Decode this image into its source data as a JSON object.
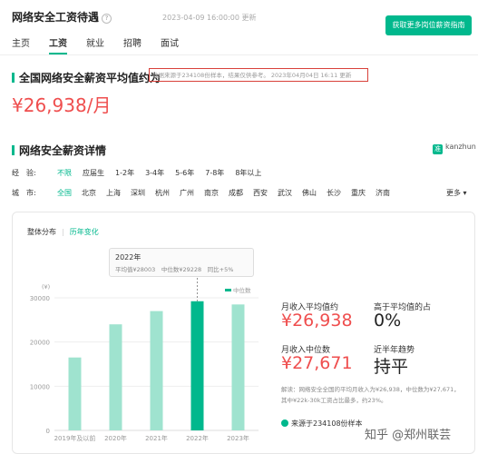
{
  "header": {
    "title": "网络安全工资待遇",
    "help_icon": "question-circle-icon",
    "date": "2023-04-09 16:00:00 更新",
    "cta": "获取更多岗位薪资指南",
    "tabs": [
      "主页",
      "工资",
      "就业",
      "招聘",
      "面试"
    ],
    "active_tab": "工资"
  },
  "avg": {
    "heading": "全国网络安全薪资平均值约为",
    "note": "数据来源于234108份样本，结果仅供参考。 2023年04月04日 16:11 更新",
    "value": "¥26,938/月"
  },
  "detail": {
    "heading": "网络安全薪资详情",
    "brand": "kanzhun",
    "brand_icon": "kanzhun-logo-icon",
    "experience": {
      "label": "经　验:",
      "options": [
        "不限",
        "应届生",
        "1-2年",
        "3-4年",
        "5-6年",
        "7-8年",
        "8年以上"
      ],
      "selected": "不限"
    },
    "city": {
      "label": "城　市:",
      "options": [
        "全国",
        "北京",
        "上海",
        "深圳",
        "杭州",
        "广州",
        "南京",
        "成都",
        "西安",
        "武汉",
        "佛山",
        "长沙",
        "重庆",
        "济南"
      ],
      "selected": "全国",
      "more": "更多 ▾"
    }
  },
  "card": {
    "tab_a": "整体分布",
    "tab_b": "历年变化",
    "tooltip": {
      "title": "2022年",
      "line": "平均值¥28003　中位数¥29228　同比+5%"
    }
  },
  "stats": {
    "avg_label": "月收入平均值约",
    "avg_value": "¥26,938",
    "ratio_label": "高于平均值的占",
    "ratio_value": "0%",
    "median_label": "月收入中位数",
    "median_value": "¥27,671",
    "trend_label": "近半年趋势",
    "trend_value": "持平",
    "explain": "解读：网络安全全国的平均月收入为¥26,938，中位数为¥27,671，其中¥22k-30k工资占比最多，约23%。",
    "source": "来源于234108份样本"
  },
  "watermark": "知乎 @郑州联芸",
  "colors": {
    "accent": "#00b88d",
    "bar": "#9fe3cf",
    "bar_active": "#00b88d",
    "price": "#ef4e4e"
  },
  "chart_data": {
    "type": "bar",
    "categories": [
      "2019年及以前",
      "2020年",
      "2021年",
      "2022年",
      "2023年"
    ],
    "values": [
      16500,
      24000,
      27000,
      29228,
      28500
    ],
    "highlighted": "2022年",
    "ylim": [
      0,
      30000
    ],
    "yticks": [
      0,
      10000,
      20000,
      30000
    ],
    "ylabel": "(¥)",
    "legend": [
      "中位数"
    ],
    "legend_position": "top-right",
    "grid": true
  }
}
